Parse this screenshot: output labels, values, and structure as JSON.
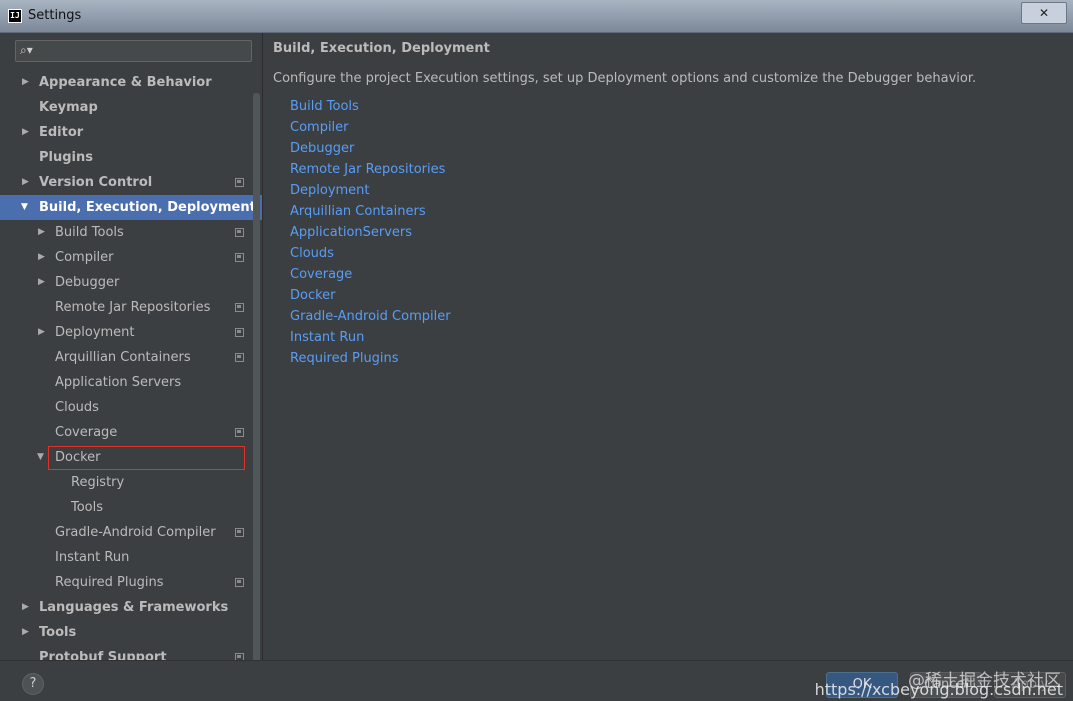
{
  "window": {
    "title": "Settings",
    "app_icon_text": "IJ",
    "close_label": "✕"
  },
  "search": {
    "value": "",
    "placeholder": ""
  },
  "tree": [
    {
      "label": "Appearance & Behavior",
      "icon": "chevron-right-icon"
    },
    {
      "label": "Keymap"
    },
    {
      "label": "Editor",
      "icon": "chevron-right-icon"
    },
    {
      "label": "Plugins"
    },
    {
      "label": "Version Control",
      "icon": "chevron-right-icon"
    },
    {
      "label": "Build, Execution, Deployment",
      "icon": "chevron-down-icon",
      "selected": true
    },
    {
      "label": "Build Tools",
      "icon": "chevron-right-icon"
    },
    {
      "label": "Compiler",
      "icon": "chevron-right-icon"
    },
    {
      "label": "Debugger",
      "icon": "chevron-right-icon"
    },
    {
      "label": "Remote Jar Repositories"
    },
    {
      "label": "Deployment",
      "icon": "chevron-right-icon"
    },
    {
      "label": "Arquillian Containers"
    },
    {
      "label": "Application Servers"
    },
    {
      "label": "Clouds"
    },
    {
      "label": "Coverage"
    },
    {
      "label": "Docker",
      "icon": "chevron-down-icon",
      "highlighted": true
    },
    {
      "label": "Registry"
    },
    {
      "label": "Tools"
    },
    {
      "label": "Gradle-Android Compiler"
    },
    {
      "label": "Instant Run"
    },
    {
      "label": "Required Plugins"
    },
    {
      "label": "Languages & Frameworks",
      "icon": "chevron-right-icon"
    },
    {
      "label": "Tools",
      "icon": "chevron-right-icon"
    },
    {
      "label": "Protobuf Support"
    }
  ],
  "main": {
    "title": "Build, Execution, Deployment",
    "description": "Configure the project Execution settings, set up Deployment options and customize the Debugger behavior.",
    "links": [
      "Build Tools",
      "Compiler",
      "Debugger",
      "Remote Jar Repositories",
      "Deployment",
      "Arquillian Containers",
      "ApplicationServers",
      "Clouds",
      "Coverage",
      "Docker",
      "Gradle-Android Compiler",
      "Instant Run",
      "Required Plugins"
    ]
  },
  "footer": {
    "help_label": "?",
    "ok_label": "OK",
    "cancel_label": "Cancel",
    "apply_label": "Apply"
  },
  "watermark": {
    "line1": "@稀土掘金技术社区",
    "line2": "https://xcbeyong.blog.csdn.net"
  },
  "colors": {
    "background": "#3c3f41",
    "selection": "#4b6eaf",
    "link": "#589df6",
    "highlight_border": "#e0312a"
  }
}
